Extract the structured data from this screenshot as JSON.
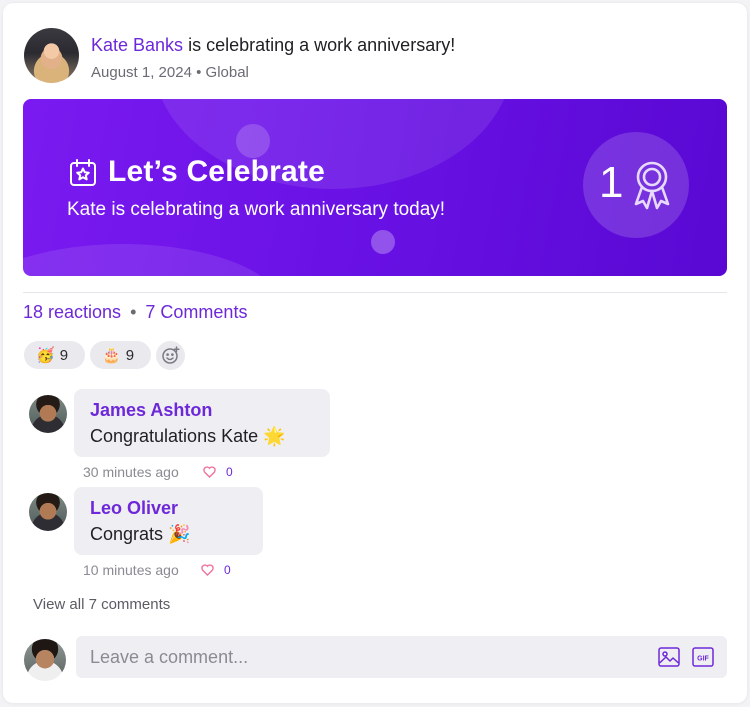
{
  "post": {
    "author": "Kate Banks",
    "headline_rest": "is celebrating a work anniversary!",
    "date": "August 1, 2024",
    "meta_sep": "•",
    "audience": "Global"
  },
  "banner": {
    "icon": "calendar-star-icon",
    "title": "Let’s Celebrate",
    "subtitle": "Kate is celebrating a work anniversary today!",
    "years": "1",
    "badge_icon": "award-ribbon-icon",
    "colors": {
      "start": "#7a1af0",
      "end": "#5908d3"
    }
  },
  "stats": {
    "reactions": "18 reactions",
    "sep": "•",
    "comments": "7 Comments"
  },
  "reactions": [
    {
      "emoji": "🥳",
      "icon": "party-face-emoji",
      "count": "9"
    },
    {
      "emoji": "🎂",
      "icon": "birthday-cake-emoji",
      "count": "9"
    }
  ],
  "add_reaction_icon": "add-reaction-icon",
  "comments": [
    {
      "author": "James Ashton",
      "text": "Congratulations Kate 🌟",
      "time": "30 minutes ago",
      "likes": "0"
    },
    {
      "author": "Leo Oliver",
      "text": "Congrats 🎉",
      "time": "10 minutes ago",
      "likes": "0"
    }
  ],
  "view_all": "View all 7 comments",
  "composer": {
    "placeholder": "Leave a comment...",
    "value": "",
    "image_icon": "image-icon",
    "gif_icon": "gif-icon"
  },
  "colors": {
    "accent": "#6d28d9",
    "like_heart": "#f0739a"
  }
}
